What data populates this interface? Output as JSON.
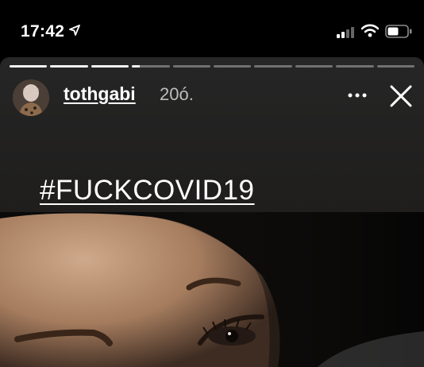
{
  "status_bar": {
    "time": "17:42",
    "icons": [
      "location-arrow-icon",
      "cellular-signal-icon",
      "wifi-icon",
      "battery-icon"
    ]
  },
  "story": {
    "progress": {
      "segments": 10,
      "completed": 3,
      "current_fraction": 0.2
    },
    "user": {
      "username": "tothgabi",
      "time_ago": "20ó."
    },
    "actions": {
      "more": "more-options-icon",
      "close": "close-icon"
    },
    "sticker_text": "#FUCKCOVID19",
    "colors": {
      "background": "#000000",
      "text": "#ffffff",
      "muted": "#bdbdbd"
    }
  }
}
